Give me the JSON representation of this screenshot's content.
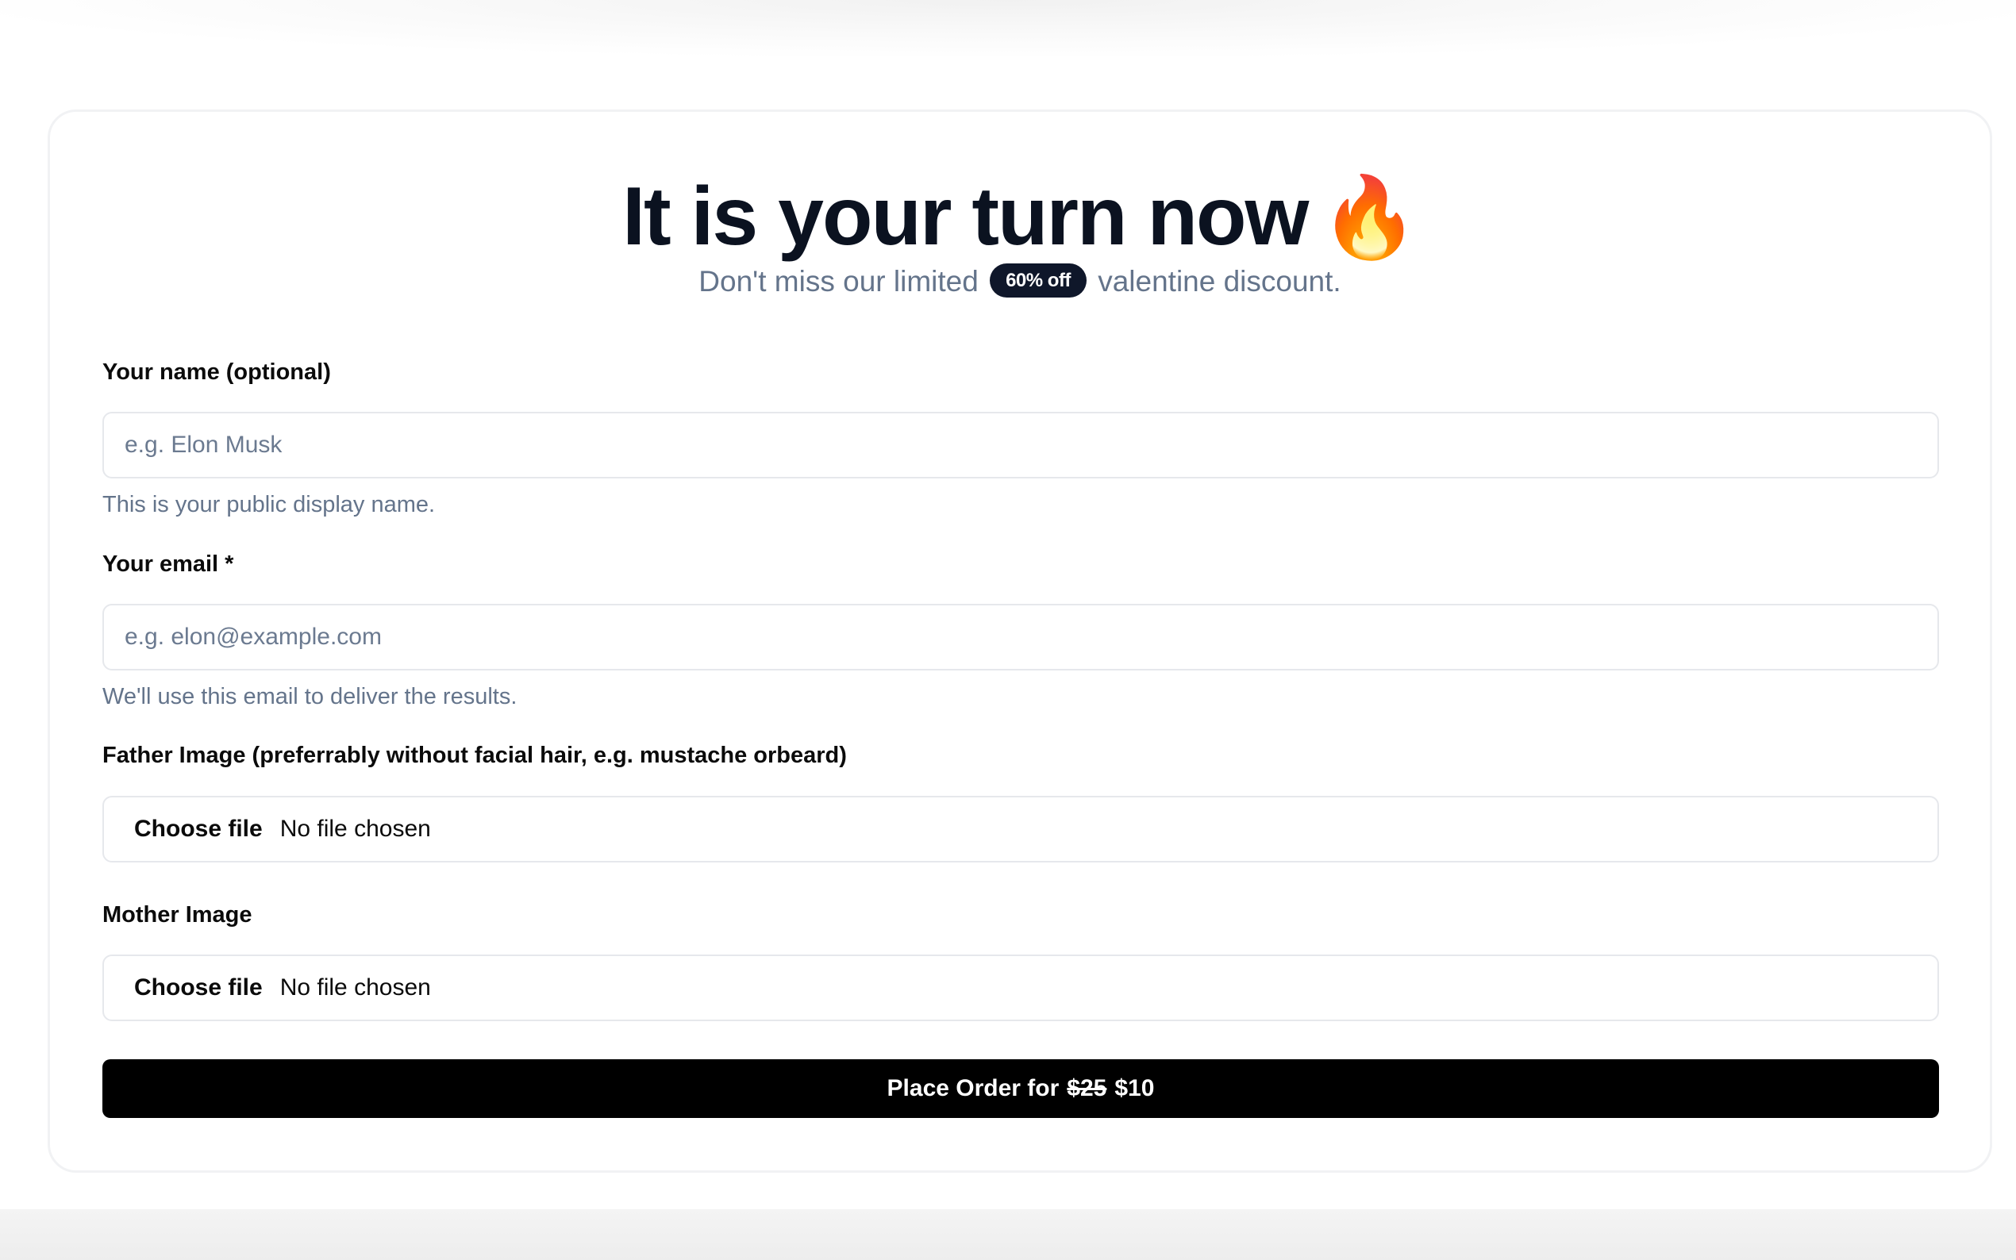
{
  "header": {
    "title": "It is your turn now",
    "title_emoji": "🔥",
    "subtitle_before": "Don't miss our limited",
    "badge": "60% off",
    "subtitle_after": "valentine discount."
  },
  "form": {
    "name": {
      "label": "Your name (optional)",
      "placeholder": "e.g. Elon Musk",
      "value": "",
      "hint": "This is your public display name."
    },
    "email": {
      "label": "Your email *",
      "placeholder": "e.g. elon@example.com",
      "value": "",
      "hint": "We'll use this email to deliver the results."
    },
    "father_image": {
      "label": "Father Image (preferrably without facial hair, e.g. mustache orbeard)",
      "button": "Choose file",
      "status": "No file chosen"
    },
    "mother_image": {
      "label": "Mother Image",
      "button": "Choose file",
      "status": "No file chosen"
    },
    "submit": {
      "label": "Place Order for",
      "old_price": "$25",
      "new_price": "$10"
    }
  },
  "colors": {
    "primary": "#000000",
    "badge_bg": "#0f172a",
    "muted_text": "#64748b",
    "border": "#e6e8ec"
  }
}
